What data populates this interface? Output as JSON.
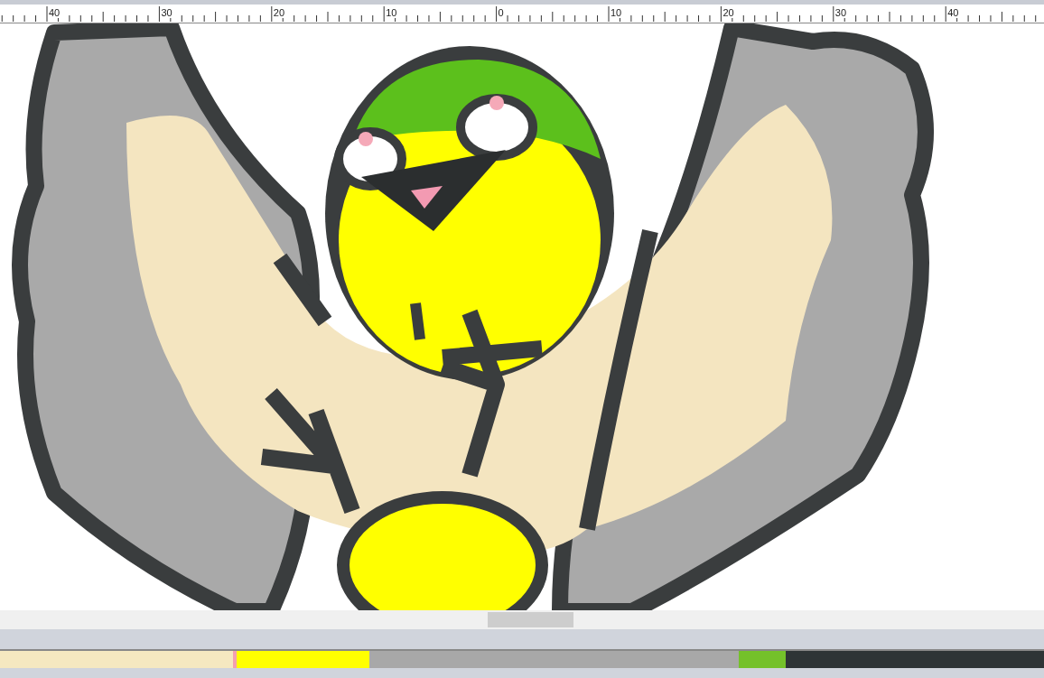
{
  "ruler": {
    "labels": [
      "40",
      "30",
      "20",
      "10",
      "0",
      "10",
      "20",
      "30",
      "40"
    ]
  },
  "color_sequence": [
    {
      "color": "#f5e8c0"
    },
    {
      "color": "#f4a0b0"
    },
    {
      "color": "#ffff00"
    },
    {
      "color": "#a8a8a8"
    },
    {
      "color": "#74c12a"
    },
    {
      "color": "#2e3436"
    }
  ]
}
